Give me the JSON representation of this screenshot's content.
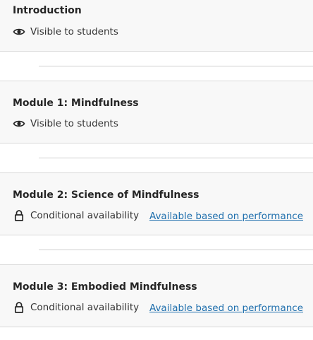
{
  "modules": [
    {
      "title": "Introduction",
      "status_icon": "eye-icon",
      "status_label": "Visible to students"
    },
    {
      "title": "Module 1: Mindfulness",
      "status_icon": "eye-icon",
      "status_label": "Visible to students"
    },
    {
      "title": "Module 2: Science of Mindfulness",
      "status_icon": "lock-icon",
      "status_label": "Conditional availability",
      "condition_link": "Available based on performance"
    },
    {
      "title": "Module 3: Embodied Mindfulness",
      "status_icon": "lock-icon",
      "status_label": "Conditional availability",
      "condition_link": "Available based on performance"
    }
  ],
  "colors": {
    "row_background": "#f8f8f8",
    "link": "#1f6fad",
    "divider": "#cfcfcf"
  }
}
